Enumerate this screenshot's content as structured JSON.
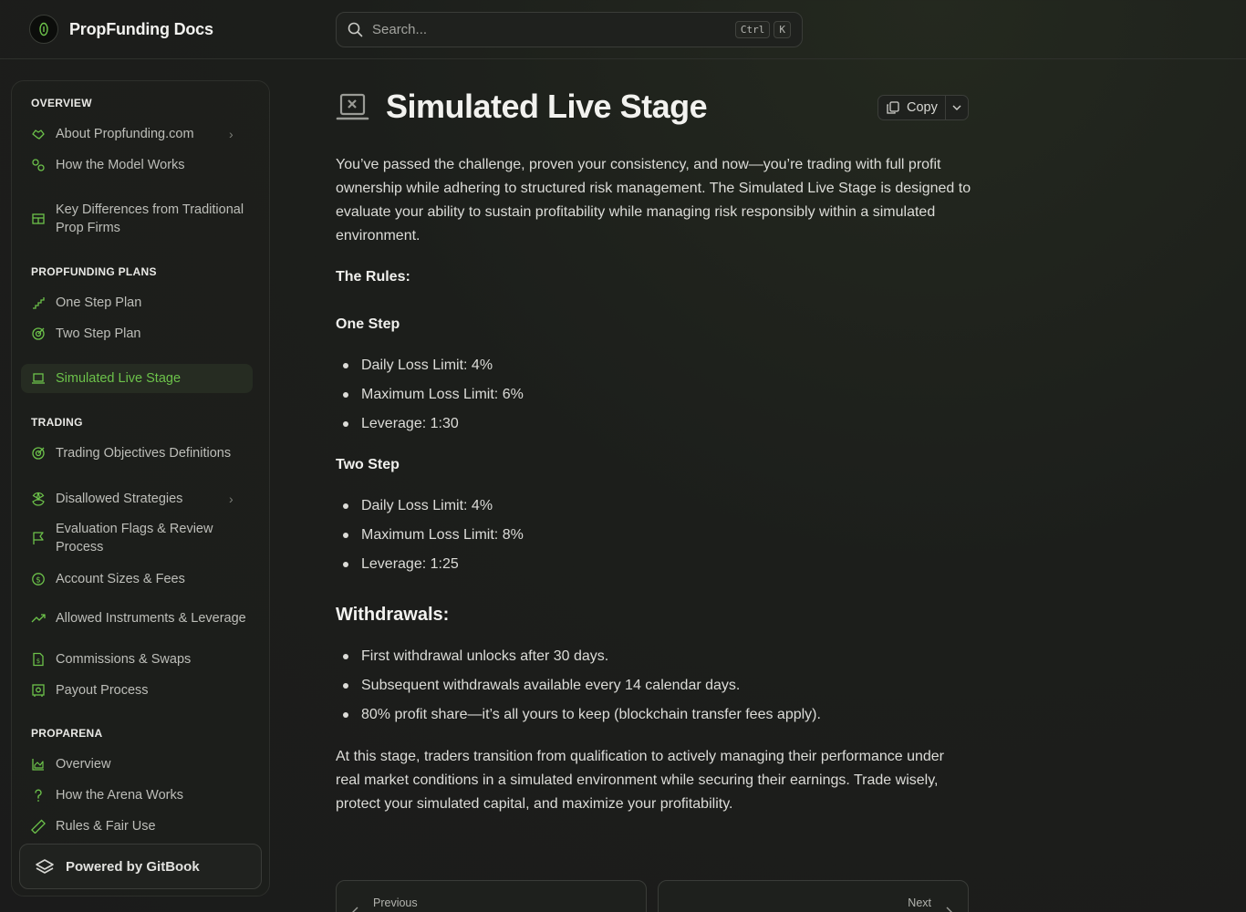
{
  "header": {
    "site_title": "PropFunding Docs",
    "search_placeholder": "Search...",
    "shortcut_keys": [
      "Ctrl",
      "K"
    ]
  },
  "sidebar": {
    "sections": [
      {
        "title": "OVERVIEW",
        "items": [
          {
            "label": "About Propfunding.com",
            "icon": "handshake-icon",
            "has_children": true
          },
          {
            "label": "How the Model Works",
            "icon": "gears-icon"
          },
          {
            "label": "Key Differences from Traditional Prop Firms",
            "icon": "table-icon"
          }
        ]
      },
      {
        "title": "PROPFUNDING PLANS",
        "items": [
          {
            "label": "One Step Plan",
            "icon": "stairs-icon"
          },
          {
            "label": "Two Step Plan",
            "icon": "target-icon"
          },
          {
            "label": "Simulated Live Stage",
            "icon": "laptop-code-icon",
            "active": true
          }
        ]
      },
      {
        "title": "TRADING",
        "items": [
          {
            "label": "Trading Objectives Definitions",
            "icon": "target-icon"
          },
          {
            "label": "Disallowed Strategies",
            "icon": "radiation-icon",
            "has_children": true
          },
          {
            "label": "Evaluation Flags & Review Process",
            "icon": "flag-icon"
          },
          {
            "label": "Account Sizes & Fees",
            "icon": "dollar-circle-icon"
          },
          {
            "label": "Allowed Instruments & Leverage",
            "icon": "trend-up-icon"
          },
          {
            "label": "Commissions & Swaps",
            "icon": "invoice-icon"
          },
          {
            "label": "Payout Process",
            "icon": "vault-icon"
          }
        ]
      },
      {
        "title": "PROPARENA",
        "items": [
          {
            "label": "Overview",
            "icon": "chart-area-icon"
          },
          {
            "label": "How the Arena Works",
            "icon": "question-icon"
          },
          {
            "label": "Rules & Fair Use",
            "icon": "ruler-icon"
          }
        ]
      }
    ],
    "powered_by": "Powered by GitBook"
  },
  "page": {
    "title": "Simulated Live Stage",
    "copy_label": "Copy",
    "intro": "You’ve passed the challenge, proven your consistency, and now—you’re trading with full profit ownership while adhering to structured risk management. The Simulated Live Stage is designed to evaluate your ability to sustain profitability while managing risk responsibly within a simulated environment.",
    "rules_heading": "The Rules:",
    "one_step": {
      "heading": "One Step",
      "bullets": [
        "Daily Loss Limit: 4%",
        "Maximum Loss Limit: 6%",
        "Leverage: 1:30"
      ]
    },
    "two_step": {
      "heading": "Two Step",
      "bullets": [
        "Daily Loss Limit: 4%",
        "Maximum Loss Limit: 8%",
        "Leverage: 1:25"
      ]
    },
    "withdrawals": {
      "heading": "Withdrawals:",
      "bullets": [
        "First withdrawal unlocks after 30 days.",
        "Subsequent withdrawals available every 14 calendar days.",
        "80% profit share—it’s all yours to keep (blockchain transfer fees apply)."
      ]
    },
    "outro": "At this stage, traders transition from qualification to actively managing their performance under real market conditions in a simulated environment while securing their earnings. Trade wisely, protect your simulated capital, and maximize your profitability.",
    "prev_label": "Previous",
    "next_label": "Next"
  },
  "colors": {
    "accent": "#6cc24a",
    "background": "#1b1c1b",
    "text": "#dcdcd8"
  }
}
